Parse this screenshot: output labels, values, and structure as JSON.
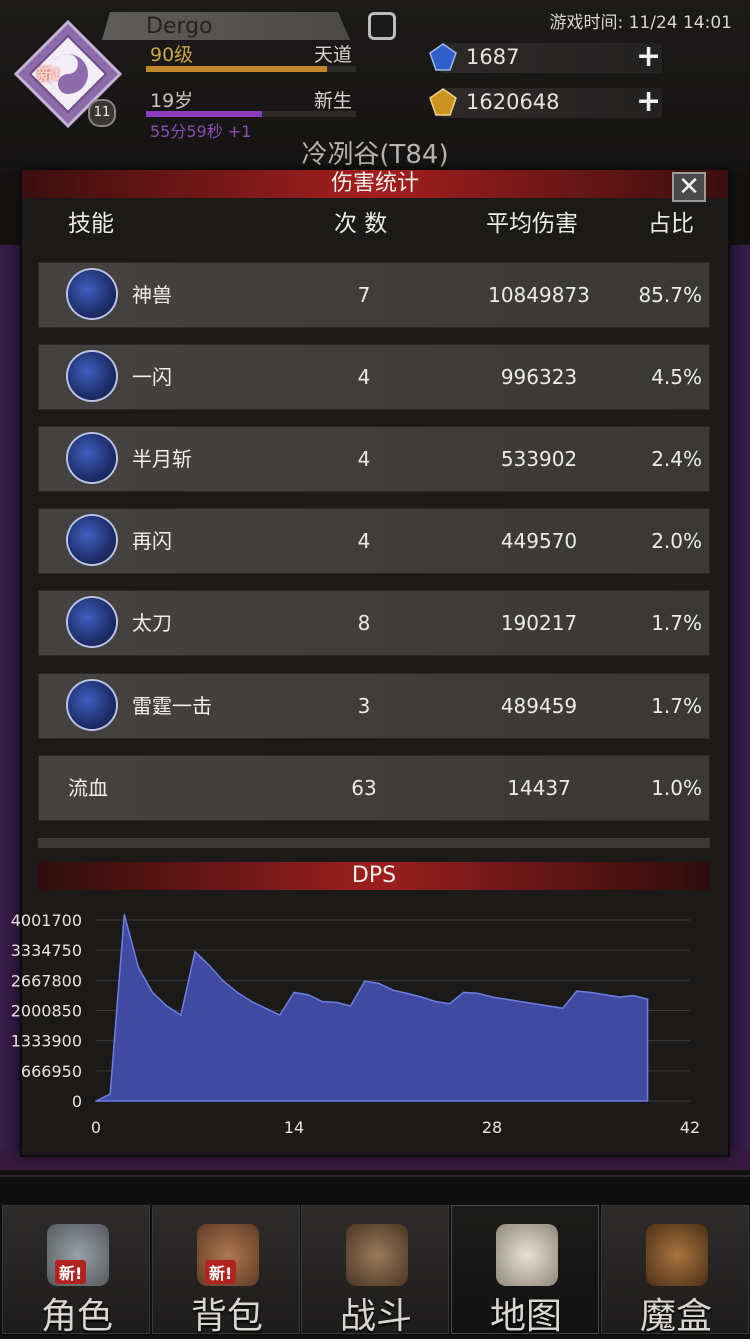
{
  "header": {
    "player_name": "Dergo",
    "level": "90级",
    "rank": "天道",
    "level_progress": 0.86,
    "age": "19岁",
    "stage": "新生",
    "age_progress": 0.55,
    "timer": "55分59秒 +1",
    "emblem_new": "新!",
    "emblem_badge": "11",
    "game_time": "游戏时间: 11/24 14:01",
    "currency": [
      {
        "name": "gem",
        "value": "1687"
      },
      {
        "name": "gold",
        "value": "1620648"
      }
    ],
    "map_title": "冷冽谷(T84)"
  },
  "panel": {
    "title": "伤害统计",
    "close_label": "✕",
    "columns": {
      "skill": "技能",
      "count": "次 数",
      "avg": "平均伤害",
      "ratio": "占比"
    },
    "rows": [
      {
        "name": "神兽",
        "count": "7",
        "avg": "10849873",
        "pct": "85.7%",
        "icon": "beast-skill-icon"
      },
      {
        "name": "一闪",
        "count": "4",
        "avg": "996323",
        "pct": "4.5%",
        "icon": "flash-skill-icon"
      },
      {
        "name": "半月斩",
        "count": "4",
        "avg": "533902",
        "pct": "2.4%",
        "icon": "half-moon-skill-icon"
      },
      {
        "name": "再闪",
        "count": "4",
        "avg": "449570",
        "pct": "2.0%",
        "icon": "reflash-skill-icon"
      },
      {
        "name": "太刀",
        "count": "8",
        "avg": "190217",
        "pct": "1.7%",
        "icon": "sword-skill-icon"
      },
      {
        "name": "雷霆一击",
        "count": "3",
        "avg": "489459",
        "pct": "1.7%",
        "icon": "thunder-skill-icon"
      },
      {
        "name": "流血",
        "count": "63",
        "avg": "14437",
        "pct": "1.0%",
        "icon": ""
      }
    ]
  },
  "dps": {
    "title": "DPS"
  },
  "chart_data": {
    "type": "area",
    "title": "DPS",
    "x": [
      0,
      1,
      2,
      3,
      4,
      5,
      6,
      7,
      8,
      9,
      10,
      11,
      12,
      13,
      14,
      15,
      16,
      17,
      18,
      19,
      20,
      21,
      22,
      23,
      24,
      25,
      26,
      27,
      28,
      29,
      30,
      31,
      32,
      33,
      34,
      35,
      36,
      37,
      38,
      39
    ],
    "y": [
      0,
      150000,
      4120000,
      2950000,
      2400000,
      2100000,
      1900000,
      3300000,
      3000000,
      2650000,
      2400000,
      2200000,
      2050000,
      1900000,
      2400000,
      2350000,
      2200000,
      2180000,
      2100000,
      2650000,
      2600000,
      2450000,
      2380000,
      2300000,
      2200000,
      2150000,
      2400000,
      2380000,
      2300000,
      2250000,
      2200000,
      2150000,
      2100000,
      2050000,
      2430000,
      2400000,
      2350000,
      2300000,
      2330000,
      2250000
    ],
    "xticks": [
      0,
      14,
      28,
      42
    ],
    "yticks": [
      0,
      666950,
      1333900,
      2000850,
      2667800,
      3334750,
      4001700
    ],
    "xlim": [
      0,
      42
    ],
    "ylim": [
      0,
      4001700
    ],
    "grid": true,
    "fill_color": "#3f4aa0",
    "line_color": "#6d7fe0"
  },
  "nav": [
    {
      "label": "角色",
      "icon": "character-icon",
      "new": "新!"
    },
    {
      "label": "背包",
      "icon": "backpack-icon",
      "new": "新!"
    },
    {
      "label": "战斗",
      "icon": "battle-icon",
      "new": ""
    },
    {
      "label": "地图",
      "icon": "map-icon",
      "new": ""
    },
    {
      "label": "魔盒",
      "icon": "magic-box-icon",
      "new": ""
    }
  ]
}
